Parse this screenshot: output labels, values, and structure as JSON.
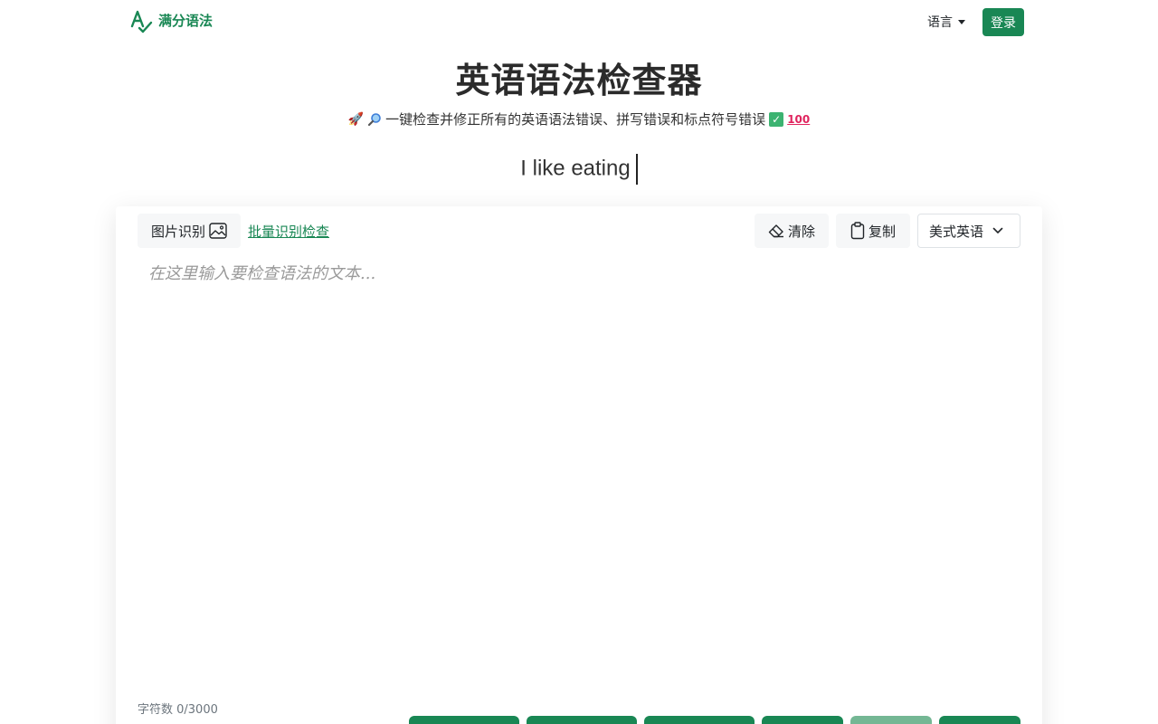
{
  "nav": {
    "brand_name": "满分语法",
    "language_label": "语言",
    "login_label": "登录"
  },
  "hero": {
    "title": "英语语法检查器",
    "subtitle": "一键检查并修正所有的英语语法错误、拼写错误和标点符号错误",
    "subtitle_emojis": [
      "rocket",
      "magnifying-glass",
      "check-mark",
      "hundred-points"
    ],
    "typing_text": "I like eating"
  },
  "toolbar": {
    "image_ocr_label": "图片识别",
    "batch_check_label": "批量识别检查",
    "clear_label": "清除",
    "copy_label": "复制",
    "dialect_selected": "美式英语"
  },
  "editor": {
    "placeholder": "在这里输入要检查语法的文本...",
    "value": "",
    "char_count_label": "字符数 0/3000"
  },
  "colors": {
    "brand_green": "#198754",
    "faded_green": "#74b794"
  }
}
